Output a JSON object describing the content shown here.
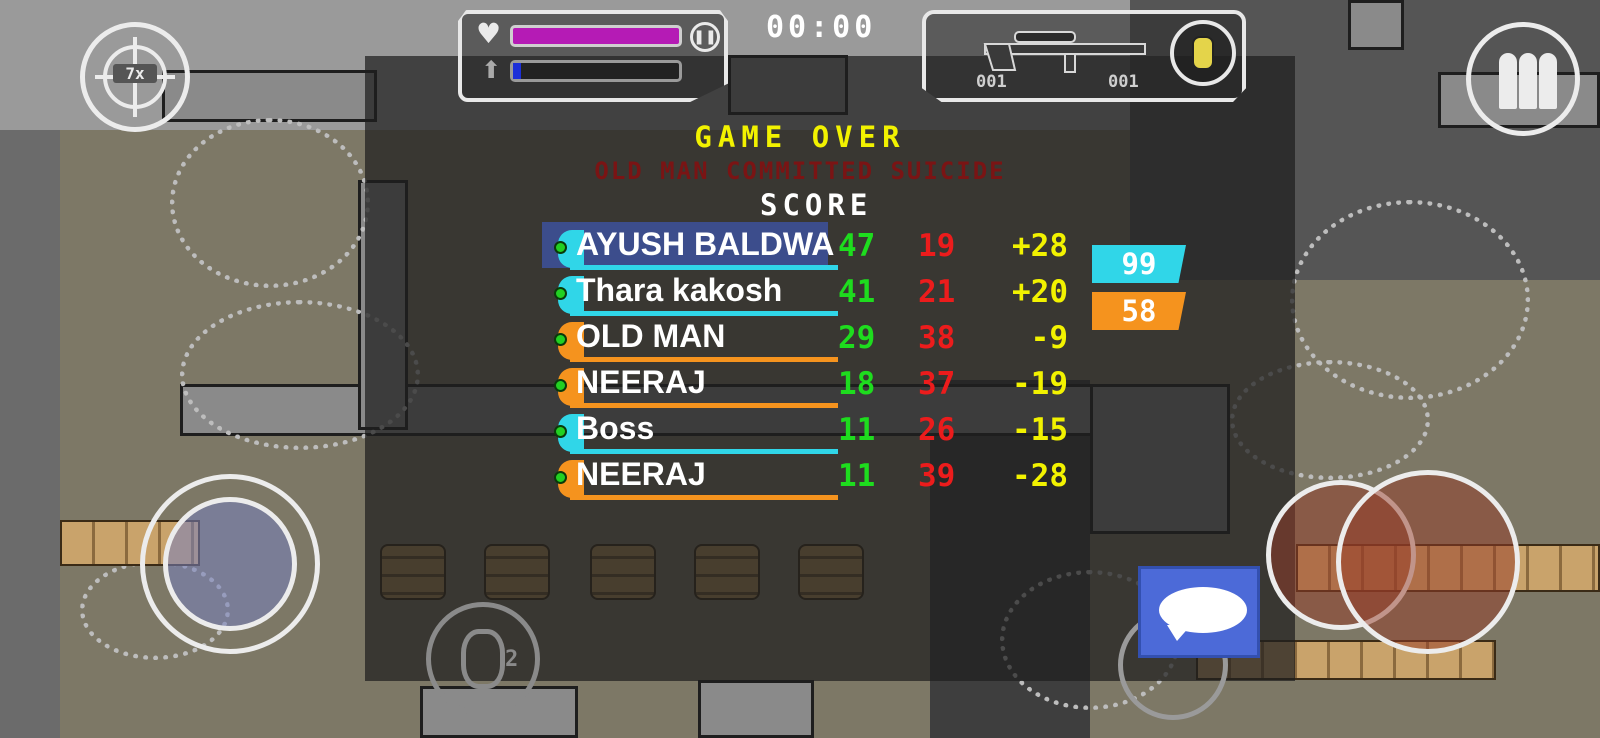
{
  "hud": {
    "timer": "00:00",
    "ammo_clip": "001",
    "ammo_reserve": "001",
    "zoom_label": "7x",
    "grenade_count": "2",
    "health_level": 1.0,
    "jetpack_level": 0.05,
    "colors": {
      "health": "#b51bb5",
      "jetpack": "#1c2fd8"
    }
  },
  "scoreboard": {
    "title": "GAME OVER",
    "death_message": "OLD MAN COMMITTED SUICIDE",
    "score_label": "SCORE",
    "players": [
      {
        "name": "AYUSH BALDWA",
        "kills": "47",
        "deaths": "19",
        "diff": "+28",
        "team": "cyan",
        "highlight": true
      },
      {
        "name": "Thara kakosh",
        "kills": "41",
        "deaths": "21",
        "diff": "+20",
        "team": "cyan",
        "highlight": false
      },
      {
        "name": "OLD MAN",
        "kills": "29",
        "deaths": "38",
        "diff": "-9",
        "team": "orange",
        "highlight": false
      },
      {
        "name": "NEERAJ",
        "kills": "18",
        "deaths": "37",
        "diff": "-19",
        "team": "orange",
        "highlight": false
      },
      {
        "name": "Boss",
        "kills": "11",
        "deaths": "26",
        "diff": "-15",
        "team": "cyan",
        "highlight": false
      },
      {
        "name": "NEERAJ",
        "kills": "11",
        "deaths": "39",
        "diff": "-28",
        "team": "orange",
        "highlight": false
      }
    ],
    "team_scores": {
      "blue": "99",
      "orange": "58"
    },
    "colors": {
      "kills": "#1edc1e",
      "deaths": "#ec1c1c",
      "diff": "#f2f200",
      "team_blue": "#30d6e8",
      "team_orange": "#f5931e"
    }
  },
  "icons": [
    "heart-icon",
    "rocket-icon",
    "pause-icon",
    "sniper-rifle-icon",
    "grenade-icon",
    "crosshair-icon",
    "bullets-icon",
    "chat-bubble-icon"
  ]
}
